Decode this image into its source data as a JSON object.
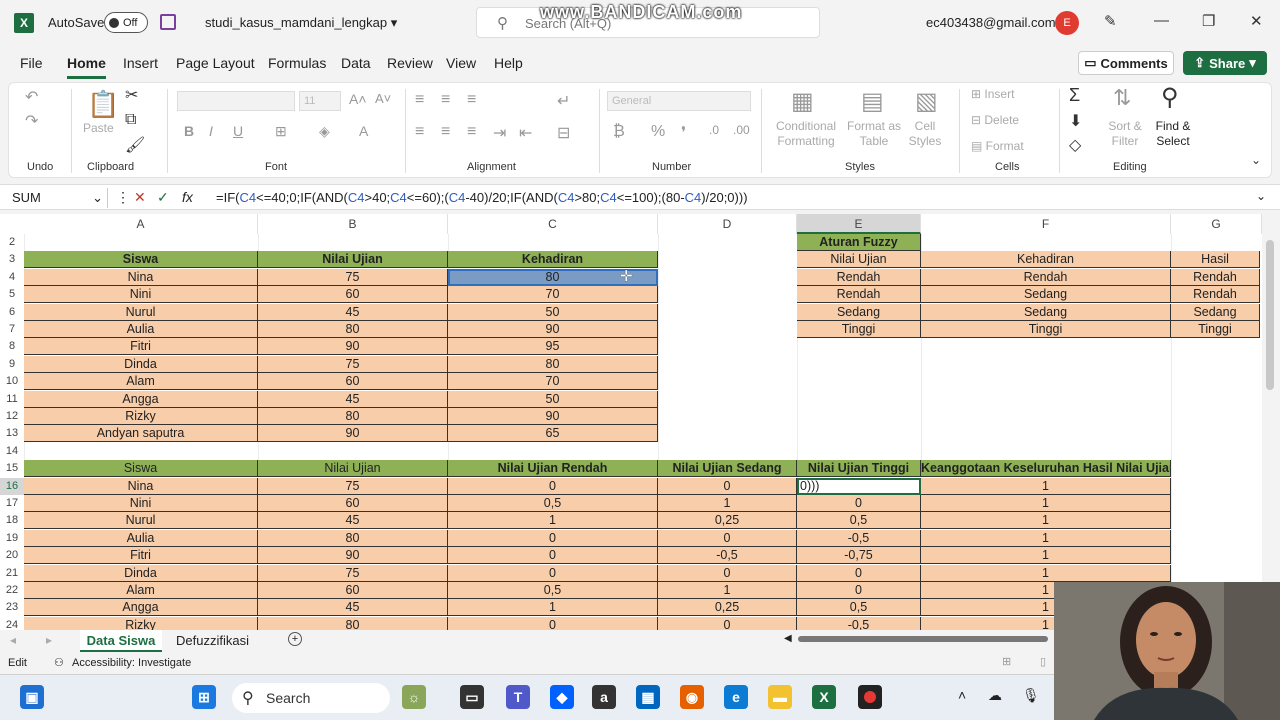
{
  "titlebar": {
    "app_logo": "X",
    "autosave_label": "AutoSave",
    "autosave_state": "Off",
    "filename": "studi_kasus_mamdani_lengkap",
    "search_placeholder": "Search (Alt+Q)",
    "watermark": "www.BANDICAM.com",
    "account_email": "ec403438@gmail.com",
    "avatar_initial": "E"
  },
  "menu": {
    "items": [
      "File",
      "Home",
      "Insert",
      "Page Layout",
      "Formulas",
      "Data",
      "Review",
      "View",
      "Help"
    ],
    "active": "Home",
    "comments_label": "Comments",
    "share_label": "Share"
  },
  "ribbon": {
    "groups": {
      "undo": "Undo",
      "clipboard": "Clipboard",
      "font": "Font",
      "alignment": "Alignment",
      "number": "Number",
      "styles": "Styles",
      "cells": "Cells",
      "editing": "Editing"
    },
    "paste_label": "Paste",
    "font_size": "11",
    "number_format": "General",
    "conditional_formatting": "Conditional Formatting",
    "format_as_table": "Format as Table",
    "cell_styles": "Cell Styles",
    "insert": "Insert",
    "delete": "Delete",
    "format": "Format",
    "sort_filter": "Sort & Filter",
    "find_select": "Find & Select"
  },
  "formula_bar": {
    "name_box": "SUM",
    "fx": "fx",
    "formula_parts": [
      {
        "t": "=IF(",
        "r": false
      },
      {
        "t": "C4",
        "r": true
      },
      {
        "t": "<=40;0;IF(AND(",
        "r": false
      },
      {
        "t": "C4",
        "r": true
      },
      {
        "t": ">40;",
        "r": false
      },
      {
        "t": "C4",
        "r": true
      },
      {
        "t": "<=60);(",
        "r": false
      },
      {
        "t": "C4",
        "r": true
      },
      {
        "t": "-40)/20;IF(AND(",
        "r": false
      },
      {
        "t": "C4",
        "r": true
      },
      {
        "t": ">80;",
        "r": false
      },
      {
        "t": "C4",
        "r": true
      },
      {
        "t": "<=100);(80-",
        "r": false
      },
      {
        "t": "C4",
        "r": true
      },
      {
        "t": ")/20;0)))",
        "r": false
      }
    ]
  },
  "sheet": {
    "columns": [
      "A",
      "B",
      "C",
      "D",
      "E",
      "F",
      "G"
    ],
    "rows": [
      "2",
      "3",
      "4",
      "5",
      "6",
      "7",
      "8",
      "9",
      "10",
      "11",
      "12",
      "13",
      "14",
      "15",
      "16",
      "17",
      "18",
      "19",
      "20",
      "21",
      "22",
      "23",
      "24"
    ],
    "table1": {
      "headers": [
        "Siswa",
        "Nilai Ujian",
        "Kehadiran"
      ],
      "rows": [
        [
          "Nina",
          "75",
          "80"
        ],
        [
          "Nini",
          "60",
          "70"
        ],
        [
          "Nurul",
          "45",
          "50"
        ],
        [
          "Aulia",
          "80",
          "90"
        ],
        [
          "Fitri",
          "90",
          "95"
        ],
        [
          "Dinda",
          "75",
          "80"
        ],
        [
          "Alam",
          "60",
          "70"
        ],
        [
          "Angga",
          "45",
          "50"
        ],
        [
          "Rizky",
          "80",
          "90"
        ],
        [
          "Andyan saputra",
          "90",
          "65"
        ]
      ]
    },
    "rules": {
      "title": "Aturan Fuzzy",
      "headers": [
        "Nilai Ujian",
        "Kehadiran",
        "Hasil"
      ],
      "rows": [
        [
          "Rendah",
          "Rendah",
          "Rendah"
        ],
        [
          "Rendah",
          "Sedang",
          "Rendah"
        ],
        [
          "Sedang",
          "Sedang",
          "Sedang"
        ],
        [
          "Tinggi",
          "Tinggi",
          "Tinggi"
        ]
      ]
    },
    "table2": {
      "headers": [
        "Siswa",
        "Nilai Ujian",
        "Nilai Ujian Rendah",
        "Nilai Ujian Sedang",
        "Nilai Ujian Tinggi",
        "Keanggotaan Keseluruhan Hasil Nilai Ujian"
      ],
      "rows": [
        [
          "Nina",
          "75",
          "0",
          "0",
          "0)))",
          "1"
        ],
        [
          "Nini",
          "60",
          "0,5",
          "1",
          "0",
          "1"
        ],
        [
          "Nurul",
          "45",
          "1",
          "0,25",
          "0,5",
          "1"
        ],
        [
          "Aulia",
          "80",
          "0",
          "0",
          "-0,5",
          "1"
        ],
        [
          "Fitri",
          "90",
          "0",
          "-0,5",
          "-0,75",
          "1"
        ],
        [
          "Dinda",
          "75",
          "0",
          "0",
          "0",
          "1"
        ],
        [
          "Alam",
          "60",
          "0,5",
          "1",
          "0",
          "1"
        ],
        [
          "Angga",
          "45",
          "1",
          "0,25",
          "0,5",
          "1"
        ],
        [
          "Rizky",
          "80",
          "0",
          "0",
          "-0,5",
          "1"
        ]
      ]
    }
  },
  "tabs": {
    "items": [
      "Data Siswa",
      "Defuzzifikasi"
    ],
    "active": "Data Siswa"
  },
  "status": {
    "mode": "Edit",
    "accessibility": "Accessibility: Investigate"
  },
  "taskbar": {
    "search_label": "Search"
  },
  "colors": {
    "excel_green": "#1d6f42",
    "header_green": "#8fb156",
    "cell_peach": "#f8cdaa",
    "selection_blue": "#7a9cc4"
  }
}
